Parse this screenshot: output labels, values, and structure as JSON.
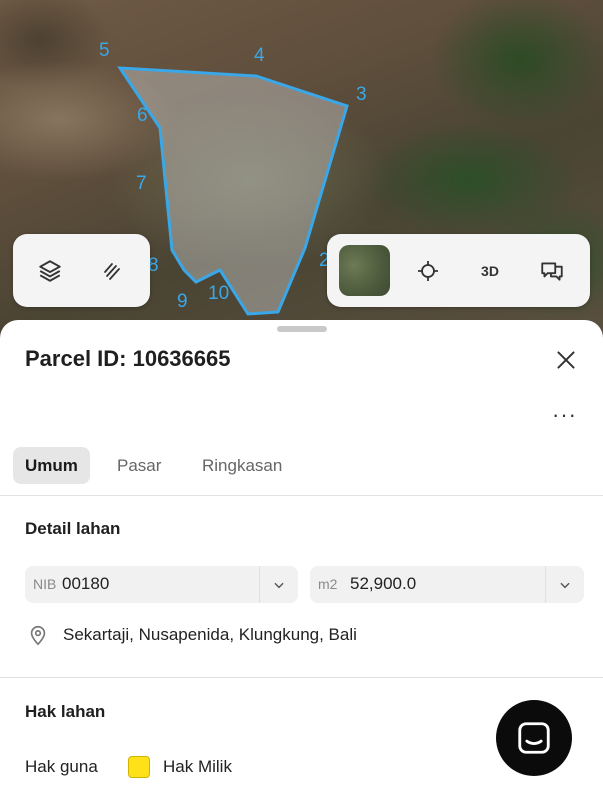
{
  "map": {
    "vertex_labels": [
      "3",
      "4",
      "5",
      "6",
      "7",
      "8",
      "9",
      "10",
      "2"
    ],
    "polygon_color": "#3aa7e8"
  },
  "left_tools": {
    "layers_icon": "layers-icon",
    "draw_icon": "freehand-draw-icon"
  },
  "right_tools": {
    "basemap_icon": "satellite-thumbnail",
    "locate_icon": "crosshair-icon",
    "three_d_label": "3D",
    "feedback_icon": "chat-bubble-icon"
  },
  "sheet": {
    "title": "Parcel ID: 10636665",
    "more_label": "···",
    "tabs": [
      {
        "label": "Umum",
        "active": true
      },
      {
        "label": "Pasar",
        "active": false
      },
      {
        "label": "Ringkasan",
        "active": false
      }
    ],
    "detail": {
      "heading": "Detail lahan",
      "nib_prefix": "NIB",
      "nib_value": "00180",
      "area_prefix": "m2",
      "area_value": "52,900.0",
      "location": "Sekartaji, Nusapenida, Klungkung, Bali"
    },
    "rights": {
      "heading": "Hak lahan",
      "row_label": "Hak guna",
      "swatch_color": "#ffe11a",
      "swatch_label": "Hak Milik"
    }
  }
}
